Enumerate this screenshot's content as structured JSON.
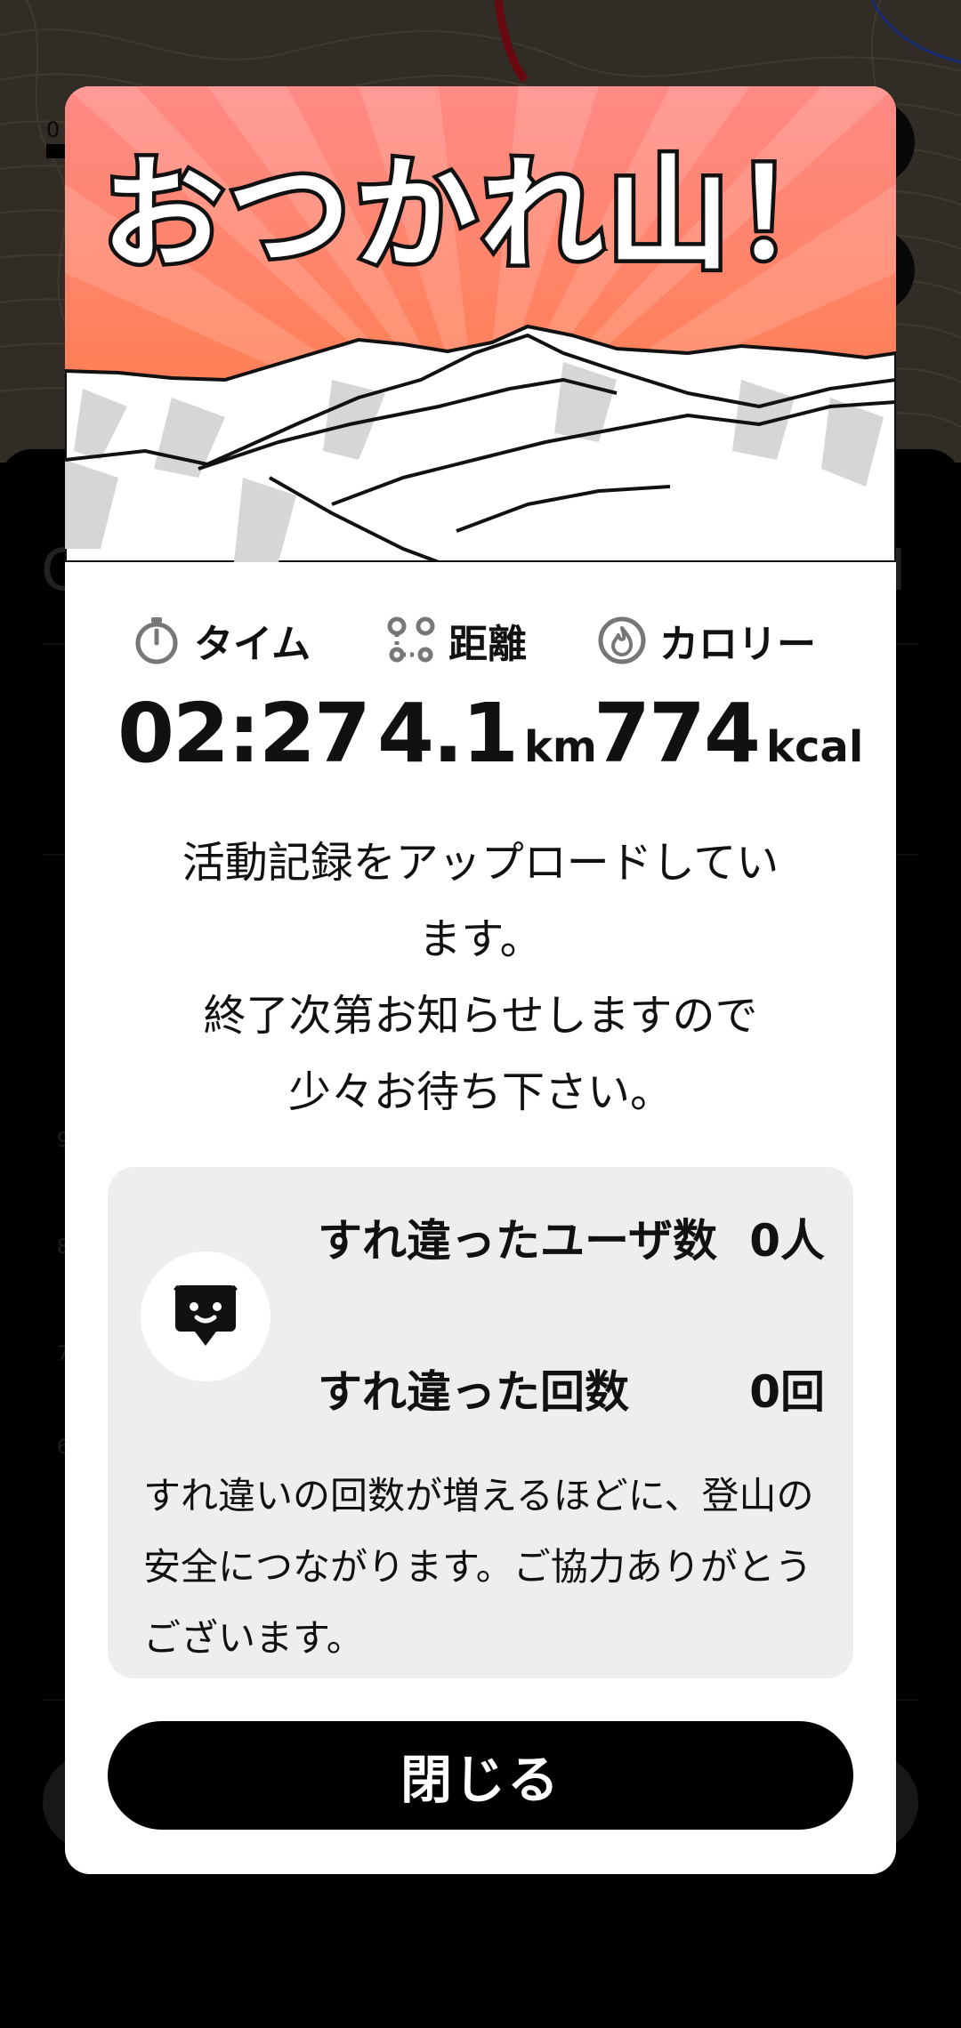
{
  "map": {
    "scale_label": "0",
    "zoom_button_icon": "layers-icon",
    "location_button_icon": "location-icon"
  },
  "modal": {
    "title": "おつかれ山！",
    "stats": {
      "time": {
        "label": "タイム",
        "value": "02:27",
        "unit": "",
        "icon": "stopwatch-icon"
      },
      "distance": {
        "label": "距離",
        "value": "4.1",
        "unit": "km",
        "icon": "route-icon"
      },
      "calories": {
        "label": "カロリー",
        "value": "774",
        "unit": "kcal",
        "icon": "flame-icon"
      }
    },
    "message": "活動記録をアップロードしてい\nます。\n終了次第お知らせしますので\n少々お待ち下さい。",
    "passby": {
      "icon": "passby-face-icon",
      "users_label": "すれ違ったユーザ数",
      "users_value": "0人",
      "count_label": "すれ違った回数",
      "count_value": "0回",
      "note": "すれ違いの回数が増えるほどに、登山の安全につながります。ご協力ありがとうございます。"
    },
    "close_label": "閉じる"
  },
  "colors": {
    "hero_top": "#ff8a7e",
    "hero_bottom": "#ff7a3c",
    "button_bg": "#000000",
    "card_bg": "#eeeeee"
  }
}
